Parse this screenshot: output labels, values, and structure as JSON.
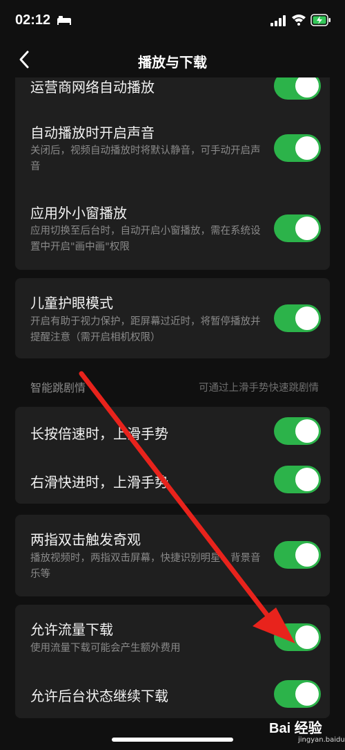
{
  "status_bar": {
    "time": "02:12"
  },
  "nav": {
    "title": "播放与下载"
  },
  "cards": [
    {
      "rows": [
        {
          "title": "运营商网络自动播放",
          "desc": "",
          "on": true
        },
        {
          "title": "自动播放时开启声音",
          "desc": "关闭后，视频自动播放时将默认静音，可手动开启声音",
          "on": true
        },
        {
          "title": "应用外小窗播放",
          "desc": "应用切换至后台时，自动开启小窗播放，需在系统设置中开启\"画中画\"权限",
          "on": true
        }
      ]
    },
    {
      "rows": [
        {
          "title": "儿童护眼模式",
          "desc": "开启有助于视力保护，距屏幕过近时，将暂停播放并提醒注意（需开启相机权限）",
          "on": true
        }
      ]
    },
    {
      "rows": [
        {
          "title": "长按倍速时，上滑手势",
          "desc": "",
          "on": true
        },
        {
          "title": "右滑快进时，上滑手势",
          "desc": "",
          "on": true
        }
      ]
    },
    {
      "rows": [
        {
          "title": "两指双击触发奇观",
          "desc": "播放视频时，两指双击屏幕，快捷识别明星、背景音乐等",
          "on": true
        }
      ]
    },
    {
      "rows": [
        {
          "title": "允许流量下载",
          "desc": "使用流量下载可能会产生额外费用",
          "on": true
        },
        {
          "title": "允许后台状态继续下载",
          "desc": "",
          "on": true
        }
      ]
    }
  ],
  "section": {
    "title": "智能跳剧情",
    "hint": "可通过上滑手势快速跳剧情"
  },
  "watermark": {
    "brand": "Bai 经验",
    "url": "jingyan.baidu.com"
  },
  "colors": {
    "background": "#101010",
    "card": "#1f1f1f",
    "toggle_on": "#2cb34a",
    "arrow": "#e8231c"
  }
}
